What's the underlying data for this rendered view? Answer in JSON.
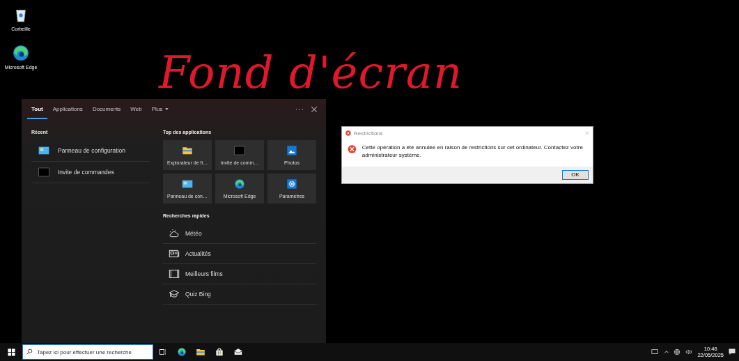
{
  "desktop": {
    "icons": [
      {
        "label": "Corbeille",
        "kind": "recycle"
      },
      {
        "label": "Microsoft Edge",
        "kind": "edge"
      }
    ],
    "wallpaper_text": "Fond d'écran"
  },
  "search_panel": {
    "tabs": [
      {
        "label": "Tout",
        "selected": true,
        "kind": "tab"
      },
      {
        "label": "Applications",
        "selected": false,
        "kind": "tab"
      },
      {
        "label": "Documents",
        "selected": false,
        "kind": "tab"
      },
      {
        "label": "Web",
        "selected": false,
        "kind": "tab"
      },
      {
        "label": "Plus",
        "selected": false,
        "kind": "menu"
      }
    ],
    "recent": {
      "title": "Récent",
      "items": [
        {
          "label": "Panneau de configuration",
          "kind": "control"
        },
        {
          "label": "Invite de commandes",
          "kind": "cmd"
        }
      ]
    },
    "top_apps": {
      "title": "Top des applications",
      "items": [
        {
          "label": "Explorateur de fi…",
          "kind": "folder"
        },
        {
          "label": "Invite de comm…",
          "kind": "cmd"
        },
        {
          "label": "Photos",
          "kind": "photos"
        },
        {
          "label": "Panneau de con…",
          "kind": "control"
        },
        {
          "label": "Microsoft Edge",
          "kind": "edge"
        },
        {
          "label": "Paramètres",
          "kind": "gear"
        }
      ]
    },
    "quick_searches": {
      "title": "Recherches rapides",
      "items": [
        {
          "label": "Météo",
          "kind": "weather"
        },
        {
          "label": "Actualités",
          "kind": "news"
        },
        {
          "label": "Meilleurs films",
          "kind": "film"
        },
        {
          "label": "Quiz Bing",
          "kind": "quiz"
        }
      ]
    }
  },
  "dialog": {
    "title": "Restrictions",
    "message": "Cette opération a été annulée en raison de restrictions sur cet ordinateur. Contactez votre administrateur système.",
    "button": "OK"
  },
  "taskbar": {
    "search_placeholder": "Tapez ici pour effectuer une recherche",
    "apps": [
      {
        "kind": "taskview"
      },
      {
        "kind": "edge"
      },
      {
        "kind": "folder"
      },
      {
        "kind": "store"
      },
      {
        "kind": "mail"
      }
    ],
    "clock": {
      "time": "10:46",
      "date": "22/05/2025"
    }
  }
}
